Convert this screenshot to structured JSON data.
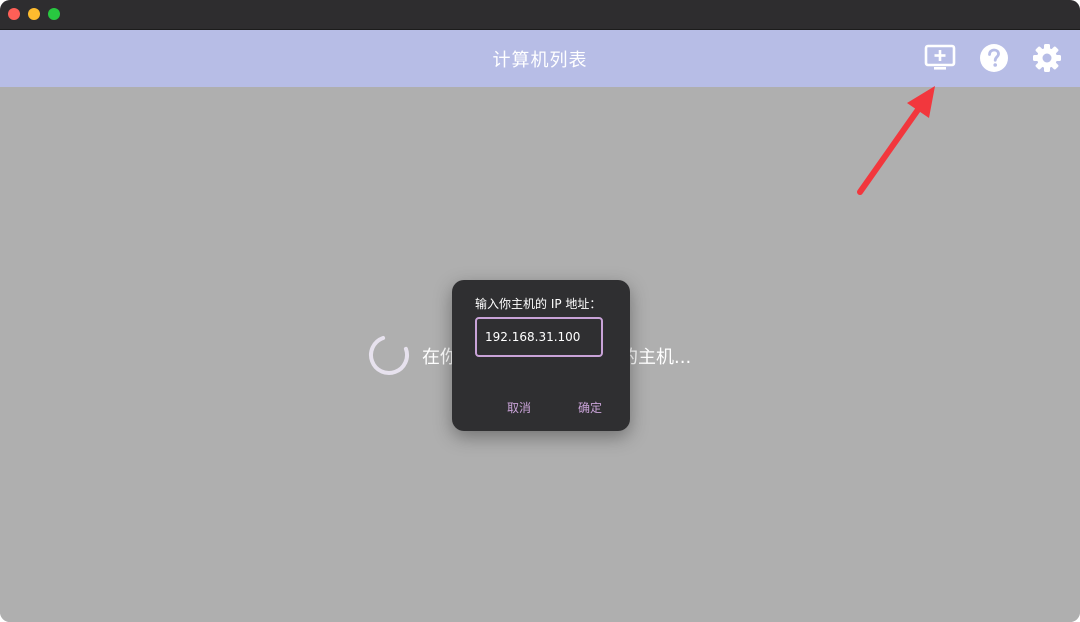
{
  "window": {
    "controls": [
      "close",
      "minimize",
      "maximize"
    ]
  },
  "appbar": {
    "title": "计算机列表",
    "icons": [
      "add-computer-icon",
      "help-icon",
      "gear-icon"
    ]
  },
  "main": {
    "loading_text": "在你的局域网中搜索兼容的主机..."
  },
  "dialog": {
    "title": "输入你主机的 IP 地址：",
    "ip_value": "192.168.31.100",
    "cancel_label": "取消",
    "ok_label": "确定"
  },
  "colors": {
    "appbar": "#b7bde6",
    "background": "#afafaf",
    "dialog": "#2f2f31",
    "accent": "#c9a3d8",
    "annotation_arrow": "#f2373d"
  }
}
